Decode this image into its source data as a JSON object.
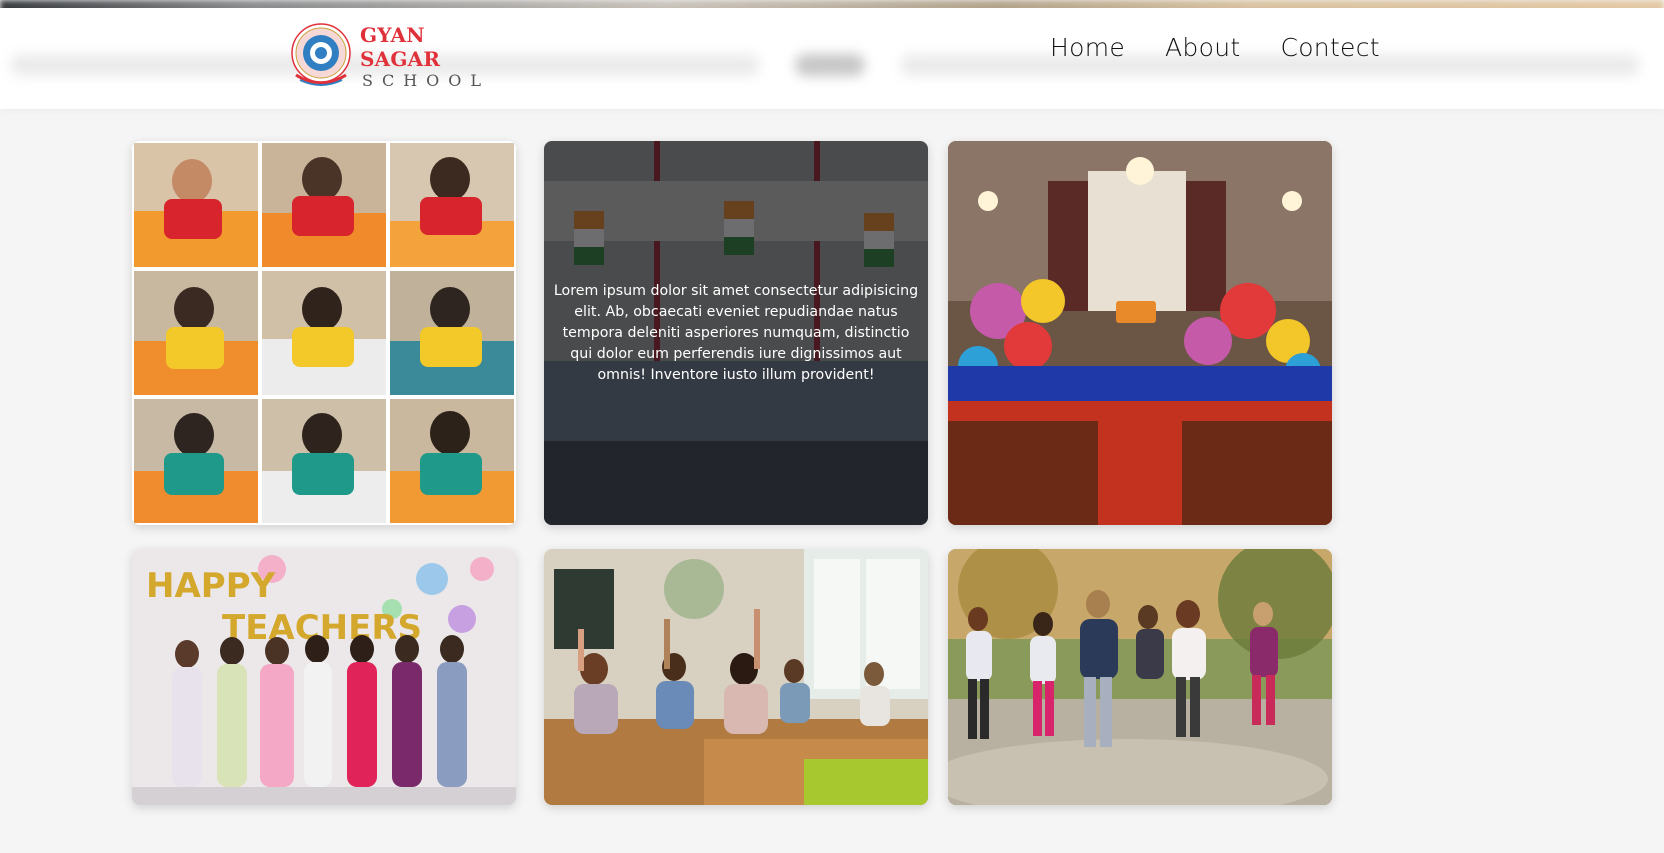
{
  "header": {
    "logo": {
      "title": "GYAN SAGAR",
      "subtitle": "SCHOOL",
      "emblem_icon": "school-crest-icon"
    },
    "nav": [
      {
        "label": "Home"
      },
      {
        "label": "About"
      },
      {
        "label": "Contect"
      }
    ]
  },
  "gallery": {
    "cards": [
      {
        "image": "children-drawing-collage"
      },
      {
        "image": "students-with-flags",
        "caption": "Lorem ipsum dolor sit amet consectetur adipisicing elit. Ab, obcaecati eveniet repudiandae natus tempora deleniti asperiores numquam, distinctio qui dolor eum perferendis iure dignissimos aut omnis! Inventore iusto illum provident!"
      },
      {
        "image": "decorated-auditorium-stage"
      },
      {
        "image": "happy-teachers-day-group"
      },
      {
        "image": "classroom-students-raising-hands"
      },
      {
        "image": "children-running-outdoors"
      }
    ]
  },
  "colors": {
    "brand_red": "#e0303a",
    "page_bg": "#f5f5f5",
    "header_bg": "#ffffff"
  }
}
